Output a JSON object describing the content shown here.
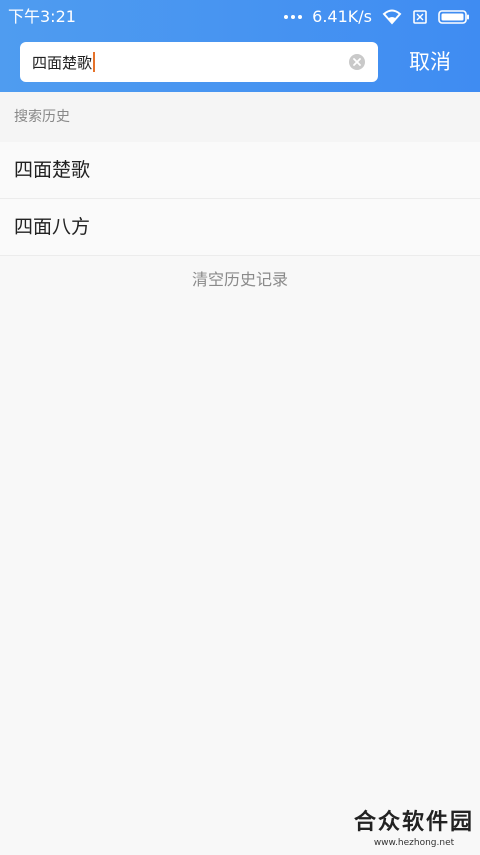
{
  "status_bar": {
    "time": "下午3:21",
    "net_speed": "6.41K/s",
    "icons": [
      "more-dots-icon",
      "wifi-icon",
      "sim-icon",
      "battery-icon"
    ]
  },
  "search": {
    "value": "四面楚歌",
    "clear_icon": "clear-circle-icon",
    "cancel_label": "取消"
  },
  "history": {
    "title": "搜索历史",
    "items": [
      {
        "label": "四面楚歌"
      },
      {
        "label": "四面八方"
      }
    ],
    "clear_label": "清空历史记录"
  },
  "watermark": {
    "name": "合众软件园",
    "url": "www.hezhong.net"
  },
  "colors": {
    "header_start": "#4f9cf0",
    "header_end": "#3f8cf2",
    "background": "#f8f8f8",
    "caret": "#e6722a"
  }
}
